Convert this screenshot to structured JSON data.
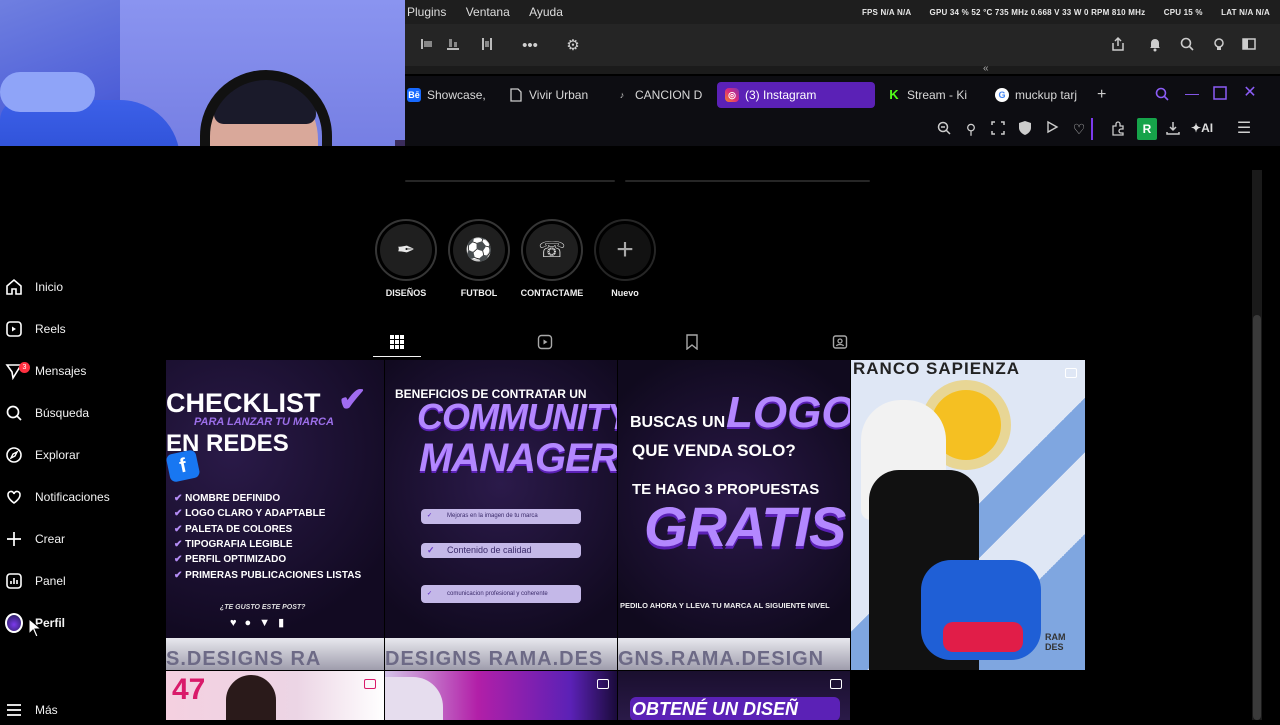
{
  "app_menu": {
    "items": [
      "Plugins",
      "Ventana",
      "Ayuda"
    ]
  },
  "perf_overlay": {
    "fps": "FPS  N/A  N/A",
    "gpu": "GPU  34 %  52 °C  735 MHz  0.668 V  33 W  0 RPM  810 MHz",
    "cpu": "CPU  15 %",
    "lat": "LAT  N/A  N/A"
  },
  "browser": {
    "tabs": [
      {
        "label": "Showcase,",
        "icon": "behance-icon",
        "color": "#1769ff"
      },
      {
        "label": "Vivir Urban",
        "icon": "document-icon",
        "color": "#d0d0d0"
      },
      {
        "label": "CANCION D",
        "icon": "music-note-icon",
        "color": "#d0d0d0"
      },
      {
        "label": "(3) Instagram",
        "icon": "instagram-icon",
        "color": "#e1306c",
        "active": true
      },
      {
        "label": "Stream - Ki",
        "icon": "kick-icon",
        "color": "#53fc18"
      },
      {
        "label": "muckup tarj",
        "icon": "google-icon",
        "color": "#4285f4"
      }
    ],
    "extension_badge": "R",
    "ai_label": "AI"
  },
  "sidebar": {
    "items": [
      {
        "label": "Inicio",
        "icon": "home-icon"
      },
      {
        "label": "Reels",
        "icon": "reels-icon"
      },
      {
        "label": "Mensajes",
        "icon": "messages-icon",
        "badge": "3"
      },
      {
        "label": "Búsqueda",
        "icon": "search-icon"
      },
      {
        "label": "Explorar",
        "icon": "compass-icon"
      },
      {
        "label": "Notificaciones",
        "icon": "heart-icon"
      },
      {
        "label": "Crear",
        "icon": "plus-icon"
      },
      {
        "label": "Panel",
        "icon": "chart-icon"
      },
      {
        "label": "Perfil",
        "icon": "avatar-icon"
      }
    ],
    "more_label": "Más"
  },
  "highlights": [
    {
      "label": "DISEÑOS",
      "icon": "pen-tool-icon"
    },
    {
      "label": "FUTBOL",
      "icon": "soccer-ball-icon"
    },
    {
      "label": "CONTACTAME",
      "icon": "phone-icon"
    },
    {
      "label": "Nuevo",
      "icon": "plus-icon"
    }
  ],
  "profile_tabs": [
    "grid-icon",
    "reels-icon",
    "saved-icon",
    "tagged-icon"
  ],
  "posts": {
    "p1": {
      "title1": "CHECKLIST",
      "subtitle": "PARA LANZAR TU MARCA",
      "title2": "EN REDES",
      "items": [
        "NOMBRE DEFINIDO",
        "LOGO CLARO Y ADAPTABLE",
        "PALETA DE COLORES",
        "TIPOGRAFIA LEGIBLE",
        "PERFIL OPTIMIZADO",
        "PRIMERAS PUBLICACIONES LISTAS"
      ],
      "question": "¿TE GUSTO ESTE POST?",
      "watermark": "S.DESIGNS RA"
    },
    "p2": {
      "kicker": "BENEFICIOS DE CONTRATAR UN",
      "title1": "COMMUNITY",
      "title2": "MANAGER",
      "pills": [
        "Mejoras en la imagen de tu marca",
        "Contenido de calidad",
        "comunicacion profesional y coherente"
      ],
      "watermark": "DESIGNS RAMA.DES"
    },
    "p3": {
      "line1": "BUSCAS UN",
      "logo": "LOGO",
      "line2": "QUE VENDA SOLO?",
      "line3": "TE HAGO 3 PROPUESTAS",
      "big": "GRATIS",
      "footer": "PEDILO AHORA Y LLEVA TU MARCA AL SIGUIENTE NIVEL",
      "watermark": "GNS.RAMA.DESIGN"
    },
    "p4": {
      "title": "RANCO SAPIENZA",
      "corner": "RAM DES"
    },
    "row2": {
      "p2_text": "",
      "p3_text": "OBTENÉ UN DISEÑ",
      "p1_text": "47"
    }
  }
}
